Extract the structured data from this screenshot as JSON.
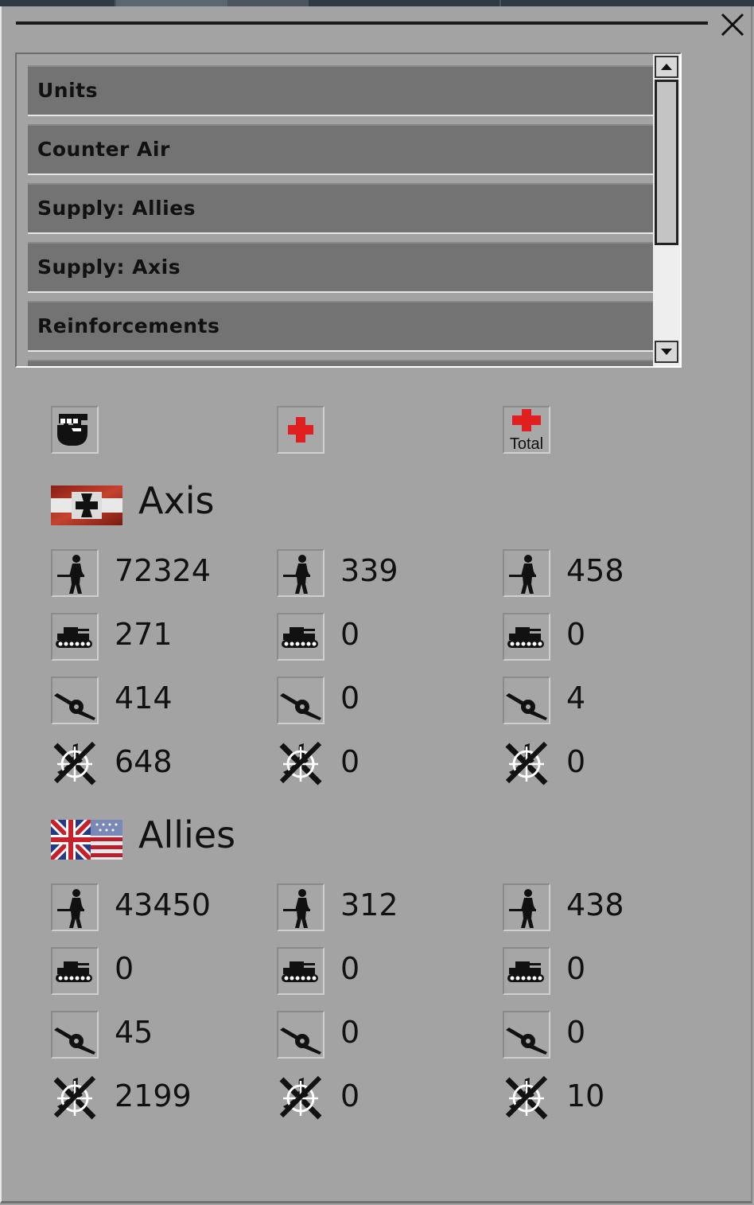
{
  "list": {
    "items": [
      {
        "label": "Units"
      },
      {
        "label": "Counter Air"
      },
      {
        "label": "Supply: Allies"
      },
      {
        "label": "Supply: Axis"
      },
      {
        "label": "Reinforcements"
      }
    ]
  },
  "columns": {
    "col1_icon": "fist-icon",
    "col2_icon": "red-cross-icon",
    "col3_icon": "red-cross-total-icon",
    "col3_text": "Total"
  },
  "axis": {
    "name": "Axis",
    "infantry": [
      "72324",
      "339",
      "458"
    ],
    "tanks": [
      "271",
      "0",
      "0"
    ],
    "artillery": [
      "414",
      "0",
      "4"
    ],
    "aircraft": [
      "648",
      "0",
      "0"
    ]
  },
  "allies": {
    "name": "Allies",
    "infantry": [
      "43450",
      "312",
      "438"
    ],
    "tanks": [
      "0",
      "0",
      "0"
    ],
    "artillery": [
      "45",
      "0",
      "0"
    ],
    "aircraft": [
      "2199",
      "0",
      "10"
    ]
  },
  "colors": {
    "panel_bg": "#a3a3a3",
    "list_item_bg": "#737373",
    "red_cross": "#e02020"
  }
}
